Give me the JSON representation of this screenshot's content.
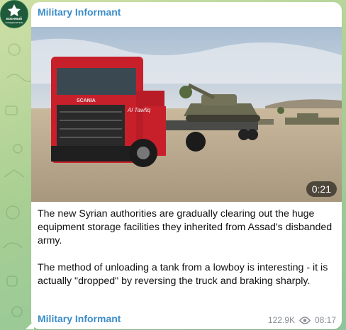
{
  "channel": {
    "name_top": "Military Informant",
    "name_bottom": "Military Informant",
    "avatar_lines": [
      "ВОЕННЫЙ",
      "ОСВЕДОМИТЕЛЬ"
    ]
  },
  "media": {
    "type": "video",
    "duration": "0:21",
    "truck_brand": "SCANIA",
    "truck_door_text": "Al Tawfiq"
  },
  "message": {
    "paragraphs": [
      "The new Syrian authorities are gradually clearing out the huge equipment storage facilities they inherited from Assad's disbanded army.",
      "The method of unloading a tank from a lowboy is interesting - it is actually \"dropped\" by reversing the truck and braking sharply."
    ]
  },
  "footer": {
    "views": "122.9K",
    "time": "08:17",
    "views_icon": "eye-icon"
  },
  "colors": {
    "channel_name": "#3a8cc8",
    "background": "#a9cf93",
    "bubble": "#ffffff"
  }
}
